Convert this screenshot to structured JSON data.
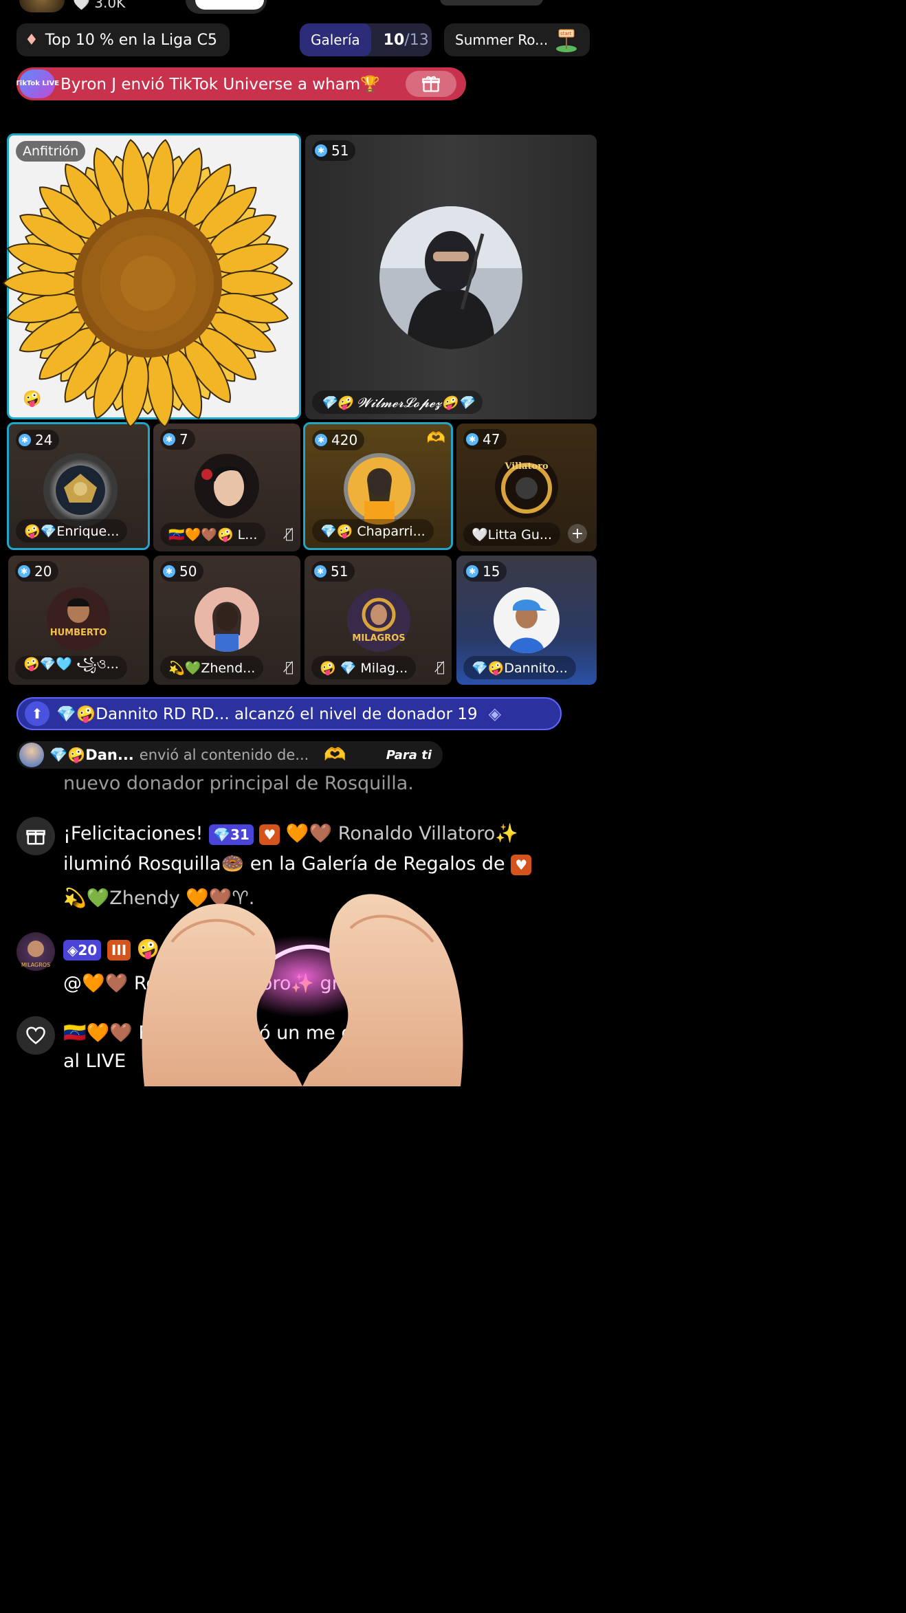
{
  "status": {
    "viewers": "3.0K"
  },
  "chips": {
    "league": "Top 10 % en la Liga C5",
    "gallery_label": "Galería",
    "gallery_current": "10",
    "gallery_total": "/13",
    "summer": "Summer Ro..."
  },
  "gift_banner": {
    "logo_text": "TikTok LIVE",
    "text": "Byron J envió TikTok Universe a wham🏆"
  },
  "host": {
    "label": "Anfitrión"
  },
  "tiles": [
    {
      "score": "51",
      "name": "💎🤪 𝓦𝓲𝓵𝓶𝓮𝓻𝓛𝓸𝓹𝓮𝔃🤪💎"
    },
    {
      "score": "24",
      "name": "🤪💎Enrique..."
    },
    {
      "score": "7",
      "name": "🇻🇪🧡🤎🤪 L..."
    },
    {
      "score": "420",
      "name": "💎🤪 Chaparri..."
    },
    {
      "score": "47",
      "name": "🤍Litta Gu..."
    },
    {
      "score": "20",
      "name": "🤪💎🩵 ꧁ও..."
    },
    {
      "score": "50",
      "name": "💫💚Zhend..."
    },
    {
      "score": "51",
      "name": "🤪 💎 Milag..."
    },
    {
      "score": "15",
      "name": "💎🤪Dannito..."
    }
  ],
  "avatar_text": {
    "humberto": "HUMBERTO",
    "milagros": "MILAGROS",
    "villatoro": "Villatoro"
  },
  "level_banner": {
    "text": "💎🤪Dannito RD RD... alcanzó el nivel de donador 19"
  },
  "gift_sent": {
    "name": "💎🤪Dan...",
    "action": "envió al contenido de...",
    "tag": "Para ti"
  },
  "chat": {
    "line0": "nuevo donador principal de Rosquilla.",
    "congrats_lead": "¡Felicitaciones!",
    "badge31": "31",
    "congrats_rest": " 🧡🤎 Ronaldo Villatoro✨",
    "congrats_line2": "iluminó Rosquilla🍩 en la Galería de Regalos de",
    "congrats_line3": "💫💚Zhendy 🧡🤎♈.",
    "badge20": "20",
    "milagros_name": "🤪 Milagros",
    "mention": "@🧡🤎 Ronaldo Villatoro✨ gr",
    "like_line1": "🇻🇪🧡🤎 ROSA🤪 envió un me gusta",
    "like_line2": "al LIVE"
  },
  "colors": {
    "accent_blue": "#1fa6c9",
    "gift_banner": "#c9324c",
    "level_banner": "#2c31a0"
  }
}
